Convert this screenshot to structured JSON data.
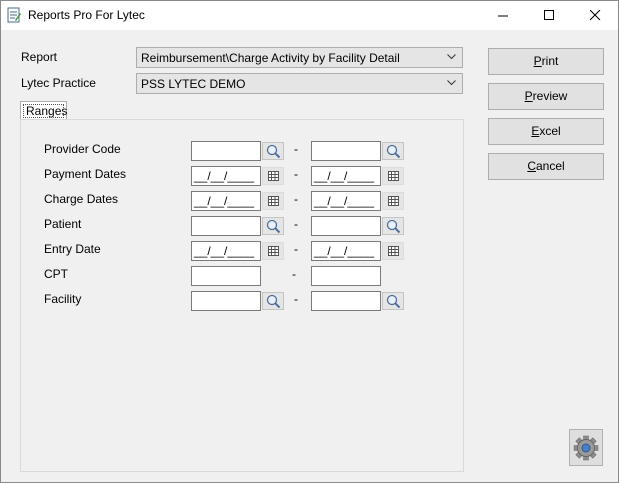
{
  "window": {
    "title": "Reports Pro For Lytec"
  },
  "form": {
    "report_label": "Report",
    "report_value": "Reimbursement\\Charge Activity by Facility Detail",
    "practice_label": "Lytec Practice",
    "practice_value": "PSS LYTEC DEMO",
    "ranges_tab": "Ranges"
  },
  "buttons": {
    "print": {
      "underline": "P",
      "rest": "rint"
    },
    "preview": {
      "underline": "P",
      "rest": "review"
    },
    "excel": {
      "underline": "E",
      "rest": "xcel"
    },
    "cancel": {
      "underline": "C",
      "rest": "ancel"
    }
  },
  "ranges": {
    "separator": "-",
    "date_mask": "__/__/____",
    "rows": [
      {
        "label": "Provider Code",
        "type": "lookup"
      },
      {
        "label": "Payment Dates",
        "type": "date"
      },
      {
        "label": "Charge Dates",
        "type": "date"
      },
      {
        "label": "Patient",
        "type": "lookup"
      },
      {
        "label": "Entry Date",
        "type": "date"
      },
      {
        "label": "CPT",
        "type": "text"
      },
      {
        "label": "Facility",
        "type": "lookup"
      }
    ]
  }
}
